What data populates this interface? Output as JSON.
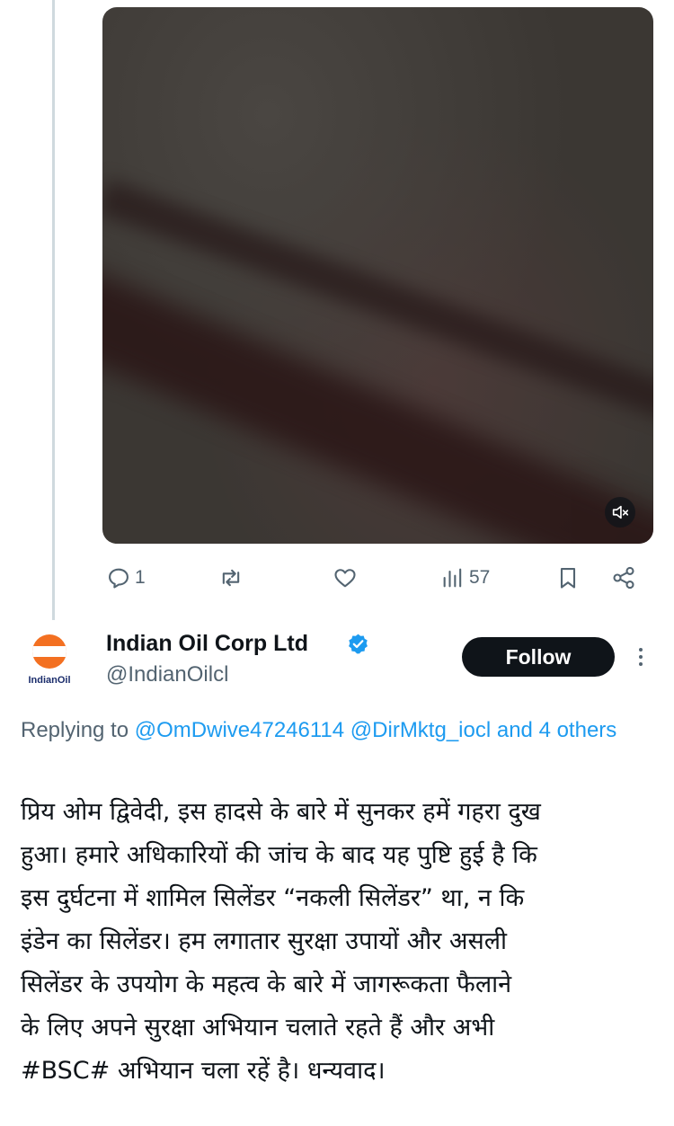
{
  "video": {
    "muted_icon": "speaker-muted-icon"
  },
  "actions": {
    "reply_count": "1",
    "repost_count": "",
    "like_count": "",
    "views_count": "57"
  },
  "author": {
    "avatar_label": "IndianOil",
    "avatar_band_text": "इंडियनऑयल",
    "name": "Indian Oil Corp Ltd",
    "handle": "@IndianOilcl",
    "follow_label": "Follow"
  },
  "reply_meta": {
    "prefix": "Replying to",
    "mention_1": "@OmDwive47246114",
    "mention_2": "@DirMktg_iocl",
    "suffix": "and 4 others"
  },
  "post": {
    "lines": [
      "प्रिय ओम द्विवेदी, इस हादसे के बारे में सुनकर हमें गहरा दुख",
      "हुआ। हमारे अधिकारियों की जांच के बाद यह पुष्टि हुई है कि",
      "इस दुर्घटना में शामिल सिलेंडर “नकली सिलेंडर” था, न कि",
      "इंडेन का सिलेंडर। हम लगातार सुरक्षा उपायों और असली",
      "सिलेंडर के उपयोग के महत्व के बारे में जागरूकता फैलाने",
      "के लिए अपने सुरक्षा अभियान चलाते रहते हैं और अभी",
      "#BSC# अभियान चला रहें है। धन्यवाद।"
    ]
  },
  "colors": {
    "text_primary": "#0f1419",
    "text_secondary": "#536471",
    "link": "#1d9bf0",
    "verified": "#1d9bf0",
    "brand_orange": "#f37021",
    "brand_navy": "#1a2c6b"
  }
}
